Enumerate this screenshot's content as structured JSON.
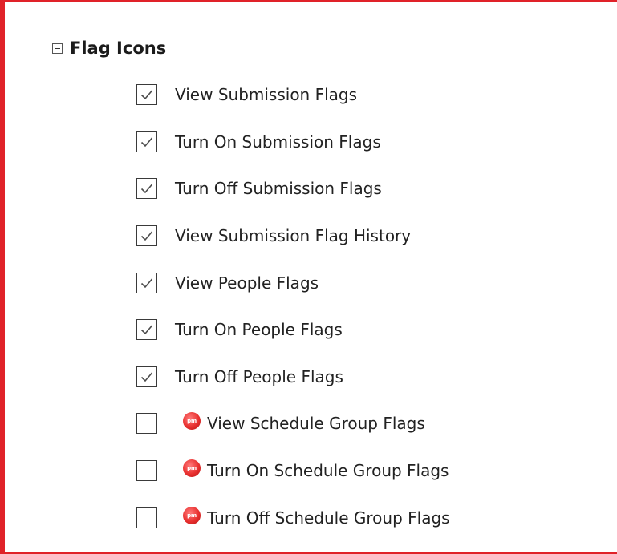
{
  "section": {
    "title": "Flag Icons",
    "collapse_icon": "minus-box-icon",
    "expanded": true
  },
  "colors": {
    "frame_border": "#e02229",
    "badge": "#e8302f",
    "text": "#222222"
  },
  "permissions": [
    {
      "label": "View Submission Flags",
      "checked": true,
      "badge": false
    },
    {
      "label": "Turn On Submission Flags",
      "checked": true,
      "badge": false
    },
    {
      "label": "Turn Off Submission Flags",
      "checked": true,
      "badge": false
    },
    {
      "label": "View Submission Flag History",
      "checked": true,
      "badge": false
    },
    {
      "label": "View People Flags",
      "checked": true,
      "badge": false
    },
    {
      "label": "Turn On People Flags",
      "checked": true,
      "badge": false
    },
    {
      "label": "Turn Off People Flags",
      "checked": true,
      "badge": false
    },
    {
      "label": "View Schedule Group Flags",
      "checked": false,
      "badge": true,
      "badge_text": "pm",
      "badge_icon": "red-circle-badge-icon"
    },
    {
      "label": "Turn On Schedule Group Flags",
      "checked": false,
      "badge": true,
      "badge_text": "pm",
      "badge_icon": "red-circle-badge-icon"
    },
    {
      "label": "Turn Off Schedule Group Flags",
      "checked": false,
      "badge": true,
      "badge_text": "pm",
      "badge_icon": "red-circle-badge-icon"
    }
  ]
}
